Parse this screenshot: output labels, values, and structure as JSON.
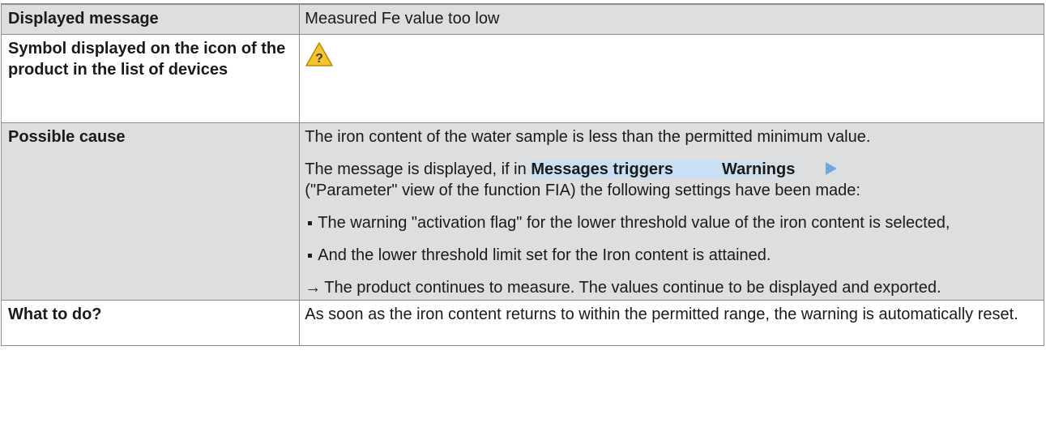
{
  "rows": {
    "displayed_message": {
      "label": "Displayed message",
      "value": "Measured Fe value too low"
    },
    "symbol": {
      "label": "Symbol displayed on the icon of the product in the list of devices",
      "icon": "warning-question-icon",
      "icon_glyph": "?",
      "icon_color": "#f7c52b"
    },
    "possible_cause": {
      "label": "Possible cause",
      "intro": "The iron content of the water sample is less than the permitted minimum value.",
      "condition_prefix": "The message is displayed, if in",
      "menu_item_1": "Messages triggers",
      "menu_item_2": "Warnings",
      "condition_suffix": "(\"Parameter\" view of the function FIA) the following settings have been made:",
      "bullets": [
        "The warning \"activation flag\" for the lower threshold value of the iron content is selected,",
        "And the lower threshold limit set for the Iron content is attained."
      ],
      "result_arrow": "→",
      "result": "The product continues to measure. The values continue to be displayed and exported."
    },
    "what_to_do": {
      "label": "What to do?",
      "value": "As soon as the iron content returns to within the permitted range, the warning is automatically reset."
    }
  },
  "colors": {
    "label_background": "#dcdee0",
    "menu_highlight": "#c9dff3",
    "menu_arrow": "#6fa8dc",
    "border": "#8c8c8c"
  }
}
